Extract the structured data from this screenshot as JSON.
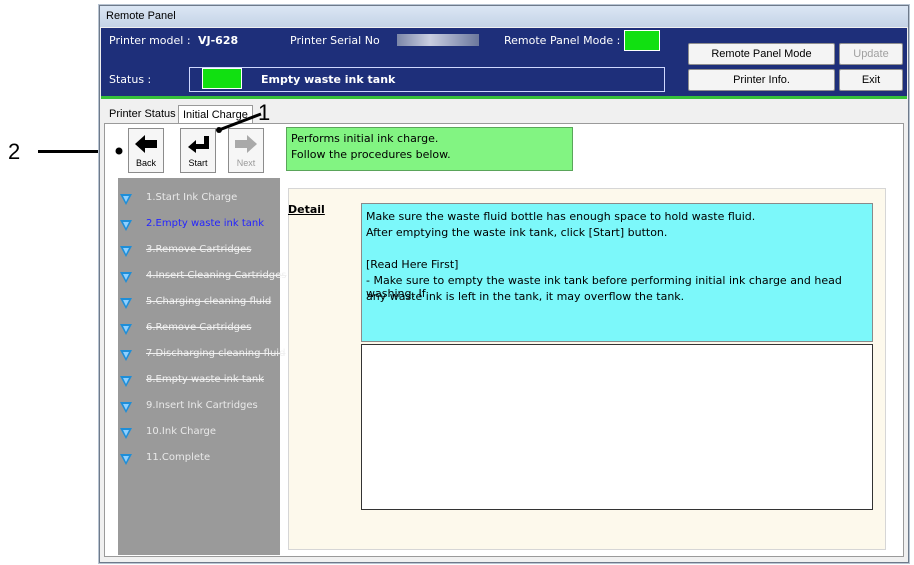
{
  "callouts": {
    "one": "1",
    "two": "2"
  },
  "window": {
    "title": "Remote Panel"
  },
  "header": {
    "printer_model_label": "Printer model :",
    "printer_model_value": "VJ-628",
    "serial_label": "Printer Serial No",
    "remote_mode_label": "Remote Panel Mode :",
    "status_label": "Status :",
    "status_text": "Empty waste ink tank",
    "indicator_color": "#11e011"
  },
  "buttons": {
    "remote_panel_mode": "Remote Panel Mode",
    "update": "Update",
    "printer_info": "Printer Info.",
    "exit": "Exit"
  },
  "tabs": [
    "Printer Status",
    "Initial Charge"
  ],
  "toolbar": {
    "back": "Back",
    "start": "Start",
    "next": "Next"
  },
  "info": {
    "line1": "Performs initial ink charge.",
    "line2": "Follow the procedures below."
  },
  "steps": [
    {
      "label": "1.Start Ink Charge",
      "state": "normal"
    },
    {
      "label": "2.Empty waste ink tank",
      "state": "current"
    },
    {
      "label": "3.Remove Cartridges",
      "state": "struck"
    },
    {
      "label": "4.Insert Cleaning Cartridges",
      "state": "struck"
    },
    {
      "label": "5.Charging cleaning fluid",
      "state": "struck"
    },
    {
      "label": "6.Remove Cartridges",
      "state": "struck"
    },
    {
      "label": "7.Discharging cleaning fluid",
      "state": "struck"
    },
    {
      "label": "8.Empty waste ink tank",
      "state": "struck"
    },
    {
      "label": "9.Insert Ink Cartridges",
      "state": "normal"
    },
    {
      "label": "10.Ink Charge",
      "state": "normal"
    },
    {
      "label": "11.Complete",
      "state": "normal"
    }
  ],
  "detail": {
    "label": "Detail",
    "lines": [
      "Make sure the waste fluid bottle has enough space to hold waste fluid.",
      "After emptying the waste ink tank, click [Start] button.",
      "",
      "[Read Here First]",
      "- Make sure to empty the waste ink tank before performing initial ink charge and head washing. If",
      "any waste ink is left in the tank, it may overflow the tank."
    ]
  }
}
